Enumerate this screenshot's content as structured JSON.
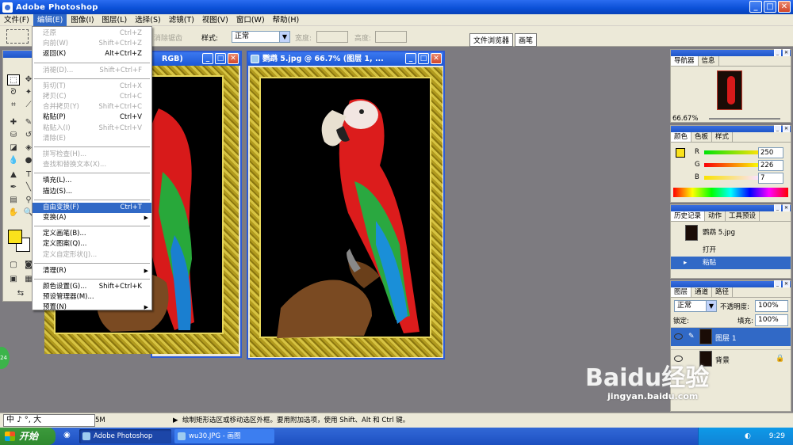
{
  "window": {
    "title": "Adobe Photoshop",
    "min": "_",
    "max": "□",
    "close": "✕"
  },
  "menubar": [
    "文件(F)",
    "编辑(E)",
    "图像(I)",
    "图层(L)",
    "选择(S)",
    "滤镜(T)",
    "视图(V)",
    "窗口(W)",
    "帮助(H)"
  ],
  "options": {
    "style_label": "样式:",
    "style_value": "正常",
    "width_label": "宽度:",
    "height_label": "高度:",
    "dim_text": "消除锯齿",
    "palette_tabs": [
      "文件浏览器",
      "画笔"
    ]
  },
  "edit_menu": {
    "groups": [
      [
        {
          "label": "还原",
          "shortcut": "Ctrl+Z",
          "disabled": true
        },
        {
          "label": "向前(W)",
          "shortcut": "Shift+Ctrl+Z",
          "disabled": true
        },
        {
          "label": "返回(K)",
          "shortcut": "Alt+Ctrl+Z",
          "disabled": false
        }
      ],
      [
        {
          "label": "消褪(D)...",
          "shortcut": "Shift+Ctrl+F",
          "disabled": true
        }
      ],
      [
        {
          "label": "剪切(T)",
          "shortcut": "Ctrl+X",
          "disabled": true
        },
        {
          "label": "拷贝(C)",
          "shortcut": "Ctrl+C",
          "disabled": true
        },
        {
          "label": "合并拷贝(Y)",
          "shortcut": "Shift+Ctrl+C",
          "disabled": true
        },
        {
          "label": "粘贴(P)",
          "shortcut": "Ctrl+V",
          "disabled": false
        },
        {
          "label": "粘贴入(I)",
          "shortcut": "Shift+Ctrl+V",
          "disabled": true
        },
        {
          "label": "清除(E)",
          "shortcut": "",
          "disabled": true
        }
      ],
      [
        {
          "label": "拼写检查(H)...",
          "shortcut": "",
          "disabled": true
        },
        {
          "label": "查找和替换文本(X)...",
          "shortcut": "",
          "disabled": true
        }
      ],
      [
        {
          "label": "填充(L)...",
          "shortcut": "",
          "disabled": false
        },
        {
          "label": "描边(S)...",
          "shortcut": "",
          "disabled": false
        }
      ],
      [
        {
          "label": "自由变换(F)",
          "shortcut": "Ctrl+T",
          "disabled": false,
          "highlighted": true
        },
        {
          "label": "变换(A)",
          "shortcut": "",
          "disabled": false,
          "submenu": true
        }
      ],
      [
        {
          "label": "定义画笔(B)...",
          "shortcut": "",
          "disabled": false
        },
        {
          "label": "定义图案(Q)...",
          "shortcut": "",
          "disabled": false
        },
        {
          "label": "定义自定形状(J)...",
          "shortcut": "",
          "disabled": true
        }
      ],
      [
        {
          "label": "清理(R)",
          "shortcut": "",
          "disabled": false,
          "submenu": true
        }
      ],
      [
        {
          "label": "颜色设置(G)...",
          "shortcut": "Shift+Ctrl+K",
          "disabled": false
        },
        {
          "label": "预设管理器(M)...",
          "shortcut": "",
          "disabled": false
        },
        {
          "label": "预置(N)",
          "shortcut": "",
          "disabled": false,
          "submenu": true
        }
      ]
    ]
  },
  "documents": {
    "left_title": "RGB)",
    "right_title": "鹦鹉 5.jpg @ 66.7% (图层 1, ..."
  },
  "navigator": {
    "tabs": [
      "导航器",
      "信息"
    ],
    "zoom": "66.67%"
  },
  "color_panel": {
    "tabs": [
      "颜色",
      "色板",
      "样式"
    ],
    "channels": [
      {
        "label": "R",
        "value": "250"
      },
      {
        "label": "G",
        "value": "226"
      },
      {
        "label": "B",
        "value": "7"
      }
    ],
    "foreground": "#fae21c"
  },
  "history_panel": {
    "tabs": [
      "历史记录",
      "动作",
      "工具预设"
    ],
    "snapshot": "鹦鹉 5.jpg",
    "steps": [
      "打开",
      "粘贴"
    ]
  },
  "layers_panel": {
    "tabs": [
      "图层",
      "通道",
      "路径"
    ],
    "blend_mode": "正常",
    "opacity_label": "不透明度:",
    "opacity": "100%",
    "lock_label": "锁定:",
    "fill_label": "填充:",
    "fill": "100%",
    "layers": [
      {
        "name": "图层 1",
        "selected": true
      },
      {
        "name": "背景",
        "selected": false,
        "locked": true
      }
    ]
  },
  "statusbar": {
    "zoom_fragment": "5M",
    "hint": "绘制矩形选区或移动选区外框。要用附加选项，使用 Shift、Alt 和 Ctrl 键。",
    "ime": "中 ♪ °, 大"
  },
  "taskbar": {
    "start": "开始",
    "tasks": [
      "Adobe Photoshop",
      "wu30.JPG - 画图"
    ],
    "clock": "9:29"
  },
  "watermark": {
    "brand": "Baidu经验",
    "url": "jingyan.baidu.com"
  },
  "badge": "24"
}
